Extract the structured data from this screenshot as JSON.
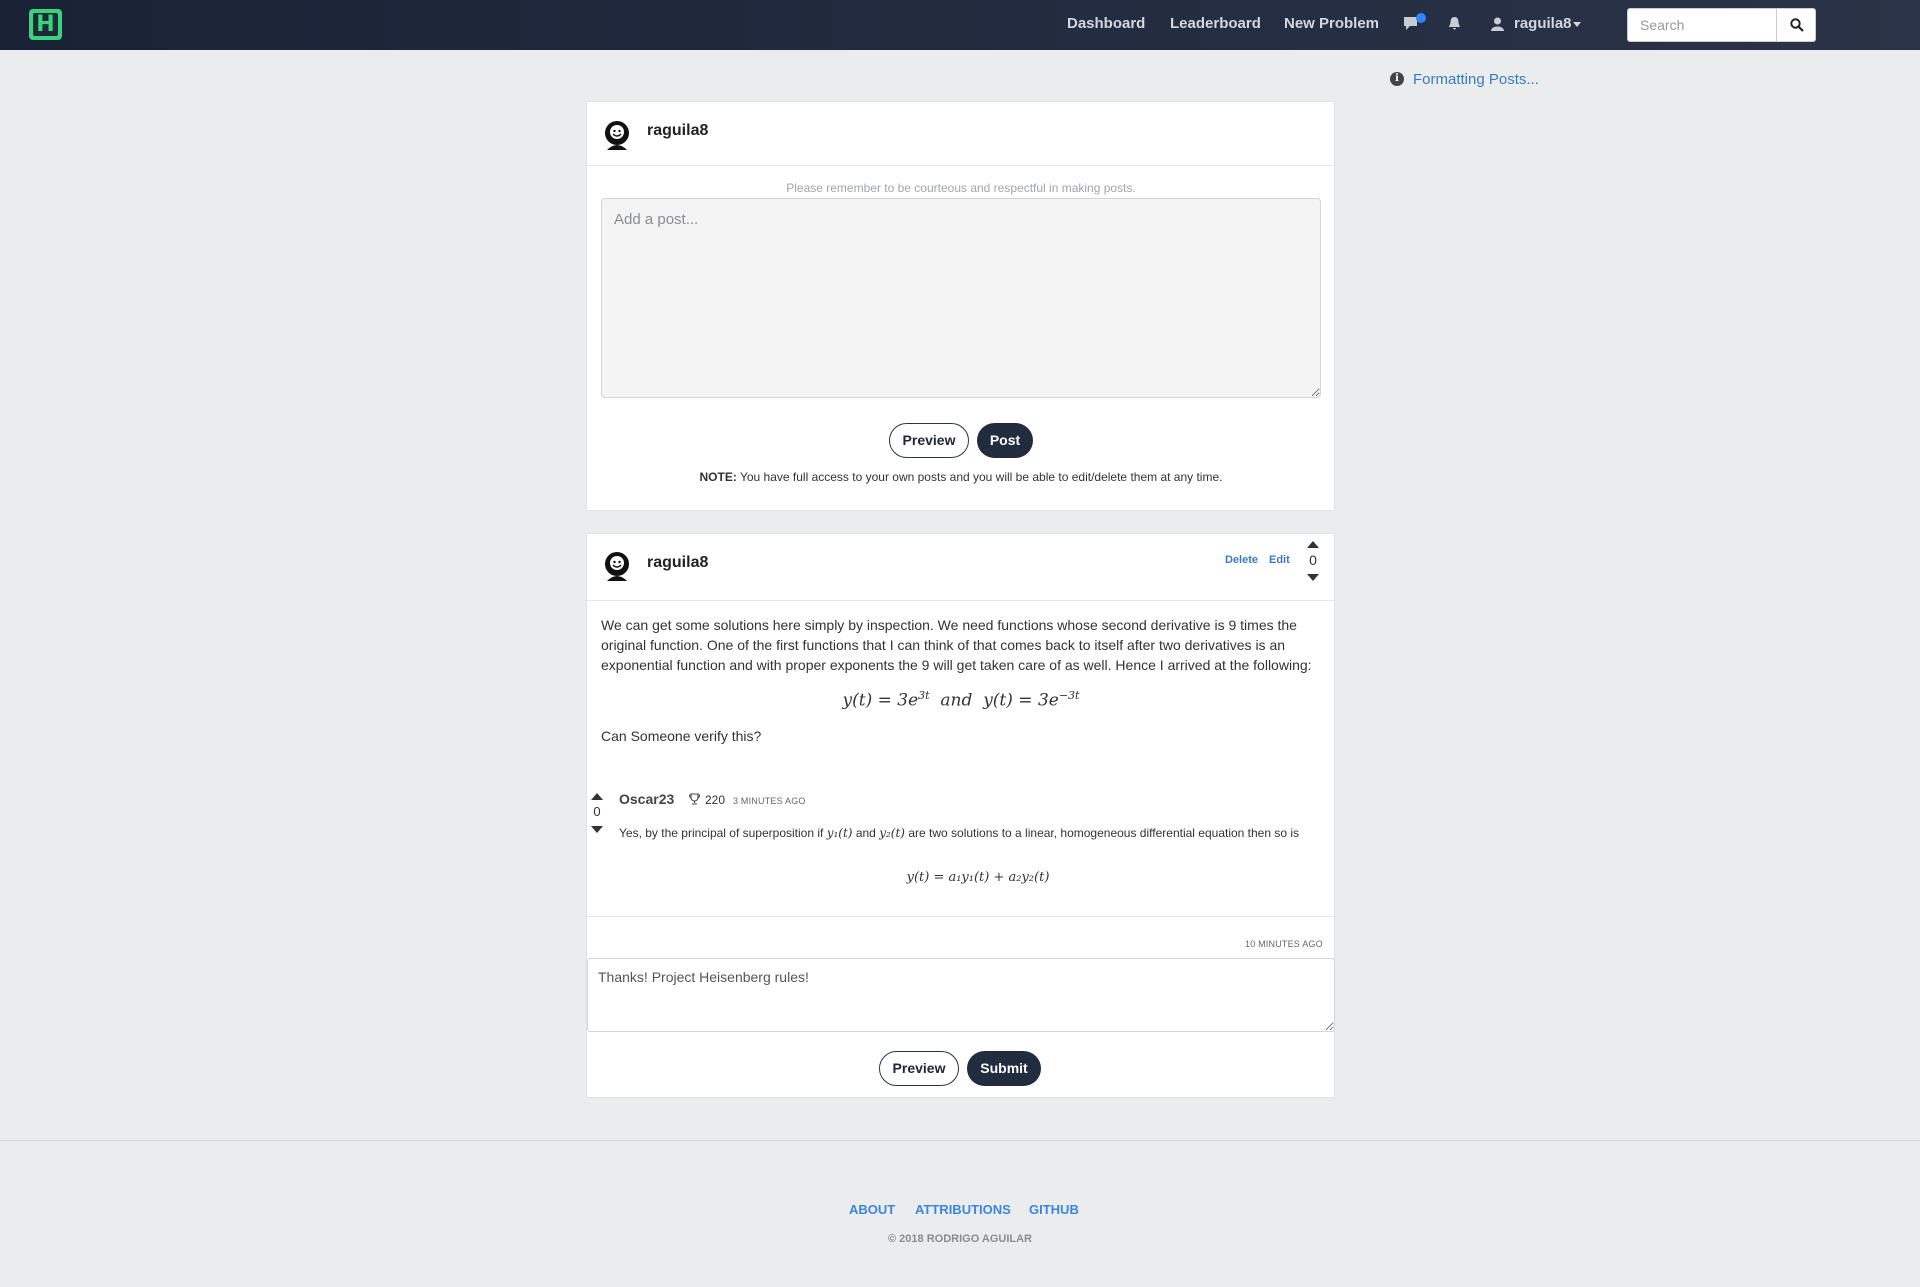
{
  "nav": {
    "logo_letter": "H",
    "links": [
      "Dashboard",
      "Leaderboard",
      "New Problem"
    ],
    "user": "raguila8",
    "search_placeholder": "Search"
  },
  "sidebar": {
    "formatting_link": "Formatting Posts..."
  },
  "composer": {
    "username": "raguila8",
    "hint": "Please remember to be courteous and respectful in making posts.",
    "placeholder": "Add a post...",
    "preview_label": "Preview",
    "post_label": "Post",
    "note_label": "NOTE:",
    "note_text": "You have full access to your own posts and you will be able to edit/delete them at any time."
  },
  "post": {
    "username": "raguila8",
    "delete_label": "Delete",
    "edit_label": "Edit",
    "votes": "0",
    "body": "We can get some solutions here simply by inspection. We need functions whose second derivative is 9 times the original function. One of the first functions that I can think of that comes back to itself after two derivatives is an exponential function and with proper exponents the 9 will get taken care of as well. Hence I arrived at the following:",
    "equation_left": "y(t) = 3e",
    "equation_left_exp": "3t",
    "equation_and": "and",
    "equation_right": "y(t) = 3e",
    "equation_right_exp": "−3t",
    "question": "Can Someone verify this?",
    "comment": {
      "author": "Oscar23",
      "points": "220",
      "time": "3 MINUTES AGO",
      "votes": "0",
      "text_before": "Yes, by the principal of superposition if",
      "y1": "y₁(t)",
      "text_and": "and",
      "y2": "y₂(t)",
      "text_after": "are two solutions to a linear, homogeneous differential equation then so is",
      "equation": "y(t) = a₁y₁(t) + a₂y₂(t)"
    },
    "reply_time": "10 MINUTES AGO",
    "reply_value": "Thanks! Project Heisenberg rules!",
    "preview_label": "Preview",
    "submit_label": "Submit"
  },
  "footer": {
    "links": [
      "ABOUT",
      "ATTRIBUTIONS",
      "GITHUB"
    ],
    "copyright": "© 2018 RODRIGO AGUILAR"
  },
  "colors": {
    "navbar": "#1e2638",
    "accent": "#39d37b",
    "link": "#3a7bbf",
    "button_dark": "#222c3f"
  }
}
